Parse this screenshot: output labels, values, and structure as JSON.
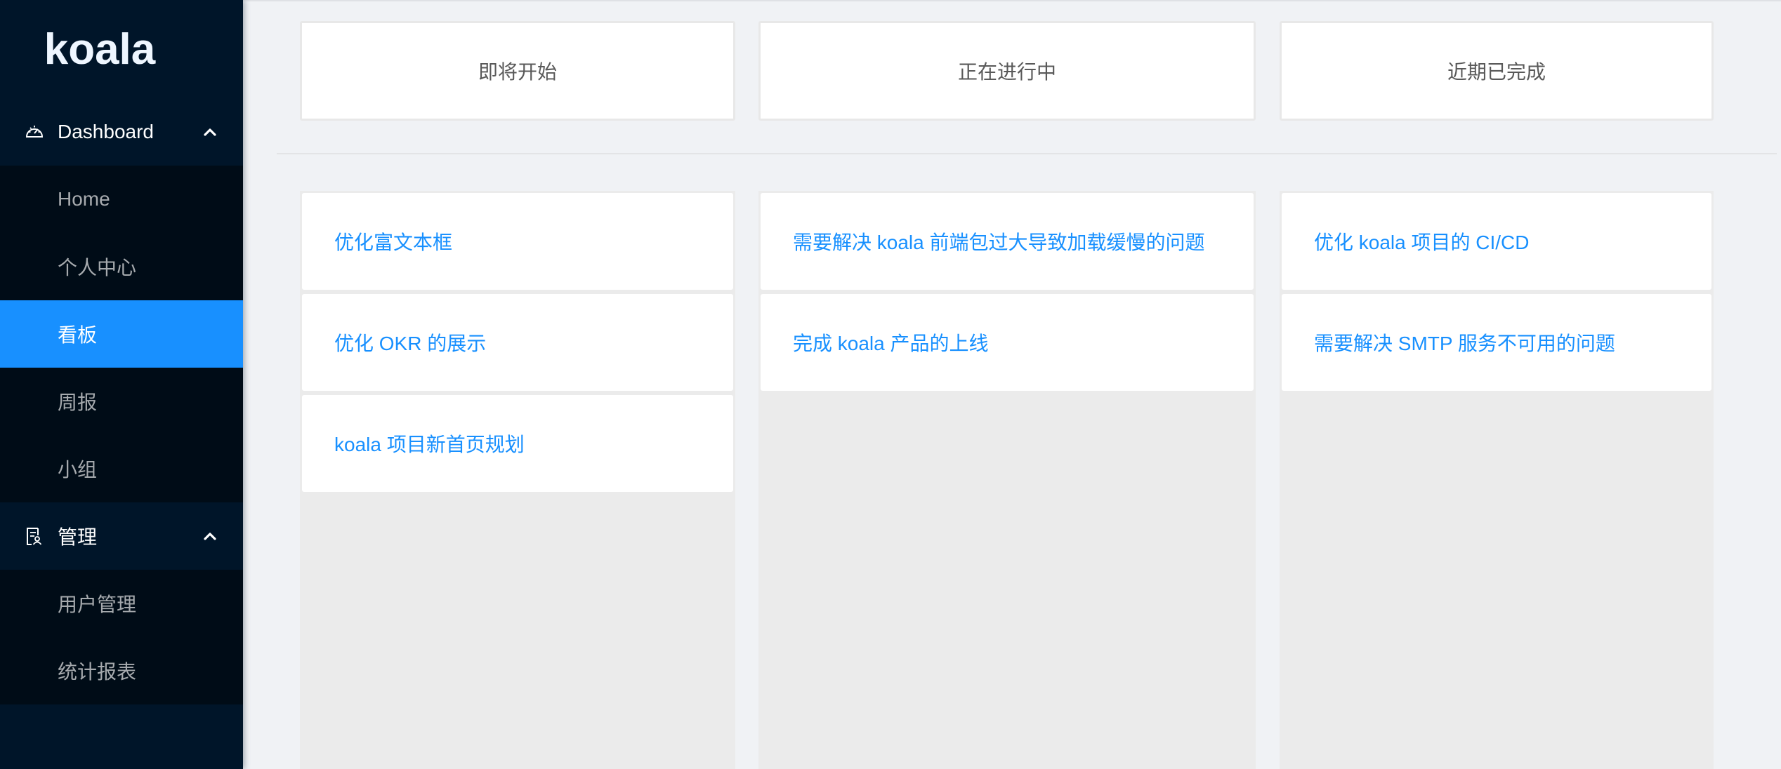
{
  "app": {
    "logo": "koala"
  },
  "colors": {
    "sidebar_bg": "#001529",
    "submenu_bg": "#000c17",
    "accent": "#1890ff",
    "page_bg": "#f0f2f5",
    "column_bg": "#ebebeb"
  },
  "sidebar": {
    "groups": [
      {
        "label": "Dashboard",
        "icon": "dashboard-icon",
        "expanded": true,
        "items": [
          {
            "label": "Home",
            "active": false
          },
          {
            "label": "个人中心",
            "active": false
          },
          {
            "label": "看板",
            "active": true
          },
          {
            "label": "周报",
            "active": false
          },
          {
            "label": "小组",
            "active": false
          }
        ]
      },
      {
        "label": "管理",
        "icon": "audit-icon",
        "expanded": true,
        "items": [
          {
            "label": "用户管理",
            "active": false
          },
          {
            "label": "统计报表",
            "active": false
          }
        ]
      }
    ]
  },
  "board": {
    "columns": [
      {
        "title": "即将开始",
        "tasks": [
          "优化富文本框",
          "优化 OKR 的展示",
          "koala 项目新首页规划"
        ]
      },
      {
        "title": "正在进行中",
        "tasks": [
          "需要解决 koala 前端包过大导致加载缓慢的问题",
          "完成 koala 产品的上线"
        ]
      },
      {
        "title": "近期已完成",
        "tasks": [
          "优化 koala 项目的 CI/CD",
          "需要解决 SMTP 服务不可用的问题"
        ]
      }
    ]
  }
}
